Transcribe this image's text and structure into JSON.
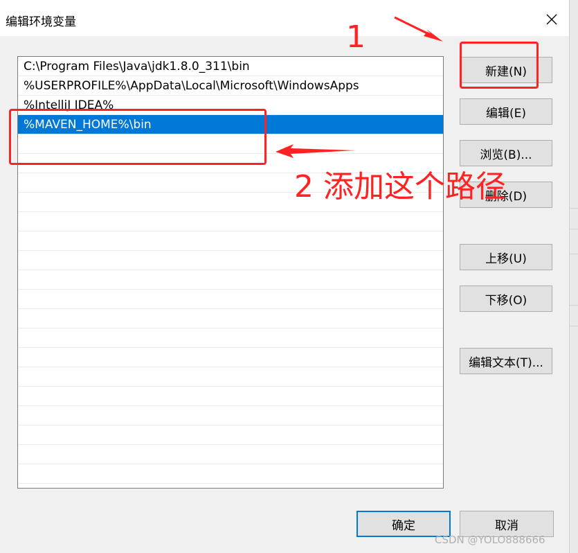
{
  "window": {
    "title": "编辑环境变量",
    "close_icon": "close-icon"
  },
  "path_list": {
    "items": [
      {
        "text": "C:\\Program Files\\Java\\jdk1.8.0_311\\bin",
        "selected": false
      },
      {
        "text": "%USERPROFILE%\\AppData\\Local\\Microsoft\\WindowsApps",
        "selected": false
      },
      {
        "text": "%IntelliJ IDEA%",
        "selected": false
      },
      {
        "text": "%MAVEN_HOME%\\bin",
        "selected": true
      }
    ],
    "empty_rows": 18
  },
  "buttons": {
    "new": "新建(N)",
    "edit": "编辑(E)",
    "browse": "浏览(B)...",
    "delete": "删除(D)",
    "move_up": "上移(U)",
    "move_down": "下移(O)",
    "edit_text": "编辑文本(T)...",
    "ok": "确定",
    "cancel": "取消"
  },
  "annotations": {
    "step1": "1",
    "step2": "2 添加这个路径",
    "color": "#ff2222"
  },
  "watermark": "CSDN @YOLO888666"
}
